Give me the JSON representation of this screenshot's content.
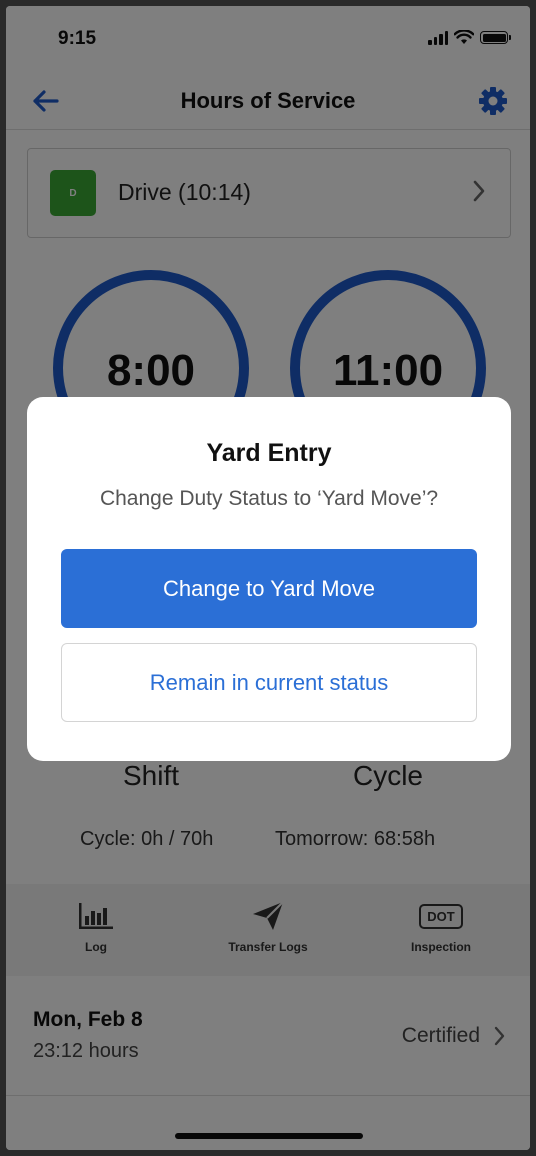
{
  "status_bar": {
    "time": "9:15"
  },
  "header": {
    "title": "Hours of Service"
  },
  "duty_status": {
    "badge": "D",
    "label": "Drive (10:14)",
    "badge_color": "#3aa835"
  },
  "gauges": {
    "shift": {
      "value": "8:00",
      "label": "Shift"
    },
    "cycle": {
      "value": "11:00",
      "label": "Cycle"
    }
  },
  "summary": {
    "cycle_used": "Cycle: 0h / 70h",
    "tomorrow": "Tomorrow: 68:58h"
  },
  "actions": [
    {
      "label": "Log",
      "icon": "bar-chart-icon"
    },
    {
      "label": "Transfer Logs",
      "icon": "paper-plane-icon"
    },
    {
      "label": "Inspection",
      "icon": "dot-badge-icon",
      "badge_text": "DOT"
    }
  ],
  "log_day": {
    "date": "Mon, Feb 8",
    "hours": "23:12 hours",
    "status": "Certified"
  },
  "dialog": {
    "title": "Yard Entry",
    "message": "Change Duty Status to ‘Yard Move’?",
    "primary_label": "Change to Yard Move",
    "secondary_label": "Remain in current status"
  },
  "colors": {
    "accent": "#2b6fd6",
    "gauge": "#1f5bcb",
    "drive_green": "#3aa835"
  }
}
